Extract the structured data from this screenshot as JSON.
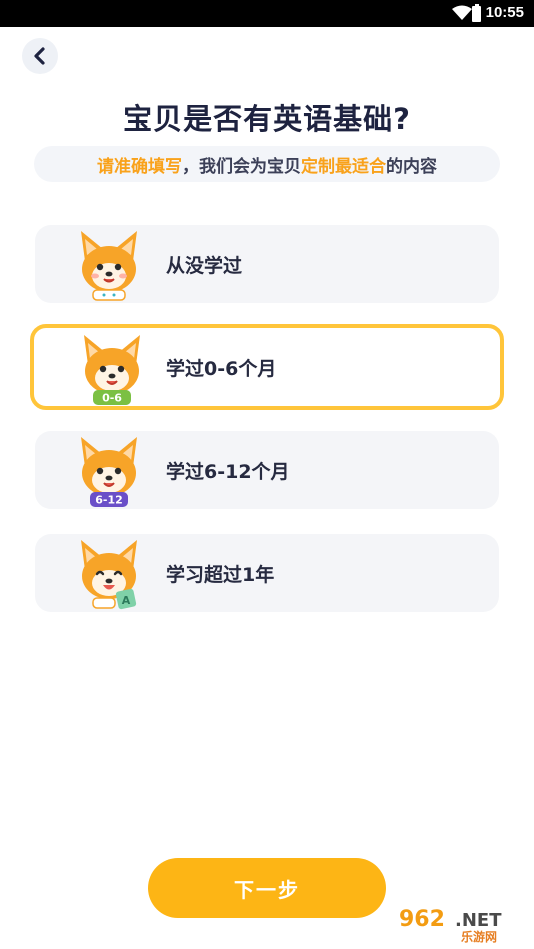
{
  "status_bar": {
    "time": "10:55"
  },
  "header": {
    "title": "宝贝是否有英语基础?",
    "subtitle_parts": {
      "hl1": "请准确填写",
      "text1": "，我们会为宝贝",
      "hl2": "定制最适合",
      "text2": "的内容"
    }
  },
  "options": [
    {
      "label": "从没学过",
      "badge": "",
      "selected": false
    },
    {
      "label": "学过0-6个月",
      "badge": "0-6",
      "selected": true
    },
    {
      "label": "学过6-12个月",
      "badge": "6-12",
      "selected": false
    },
    {
      "label": "学习超过1年",
      "badge": "A",
      "selected": false
    }
  ],
  "footer": {
    "next_label": "下一步"
  },
  "watermark": {
    "brand": "962",
    "suffix": ".NET",
    "sub": "乐游网"
  },
  "colors": {
    "accent": "#fdb515",
    "highlight": "#f9a21b",
    "selected_border": "#ffc53a"
  }
}
